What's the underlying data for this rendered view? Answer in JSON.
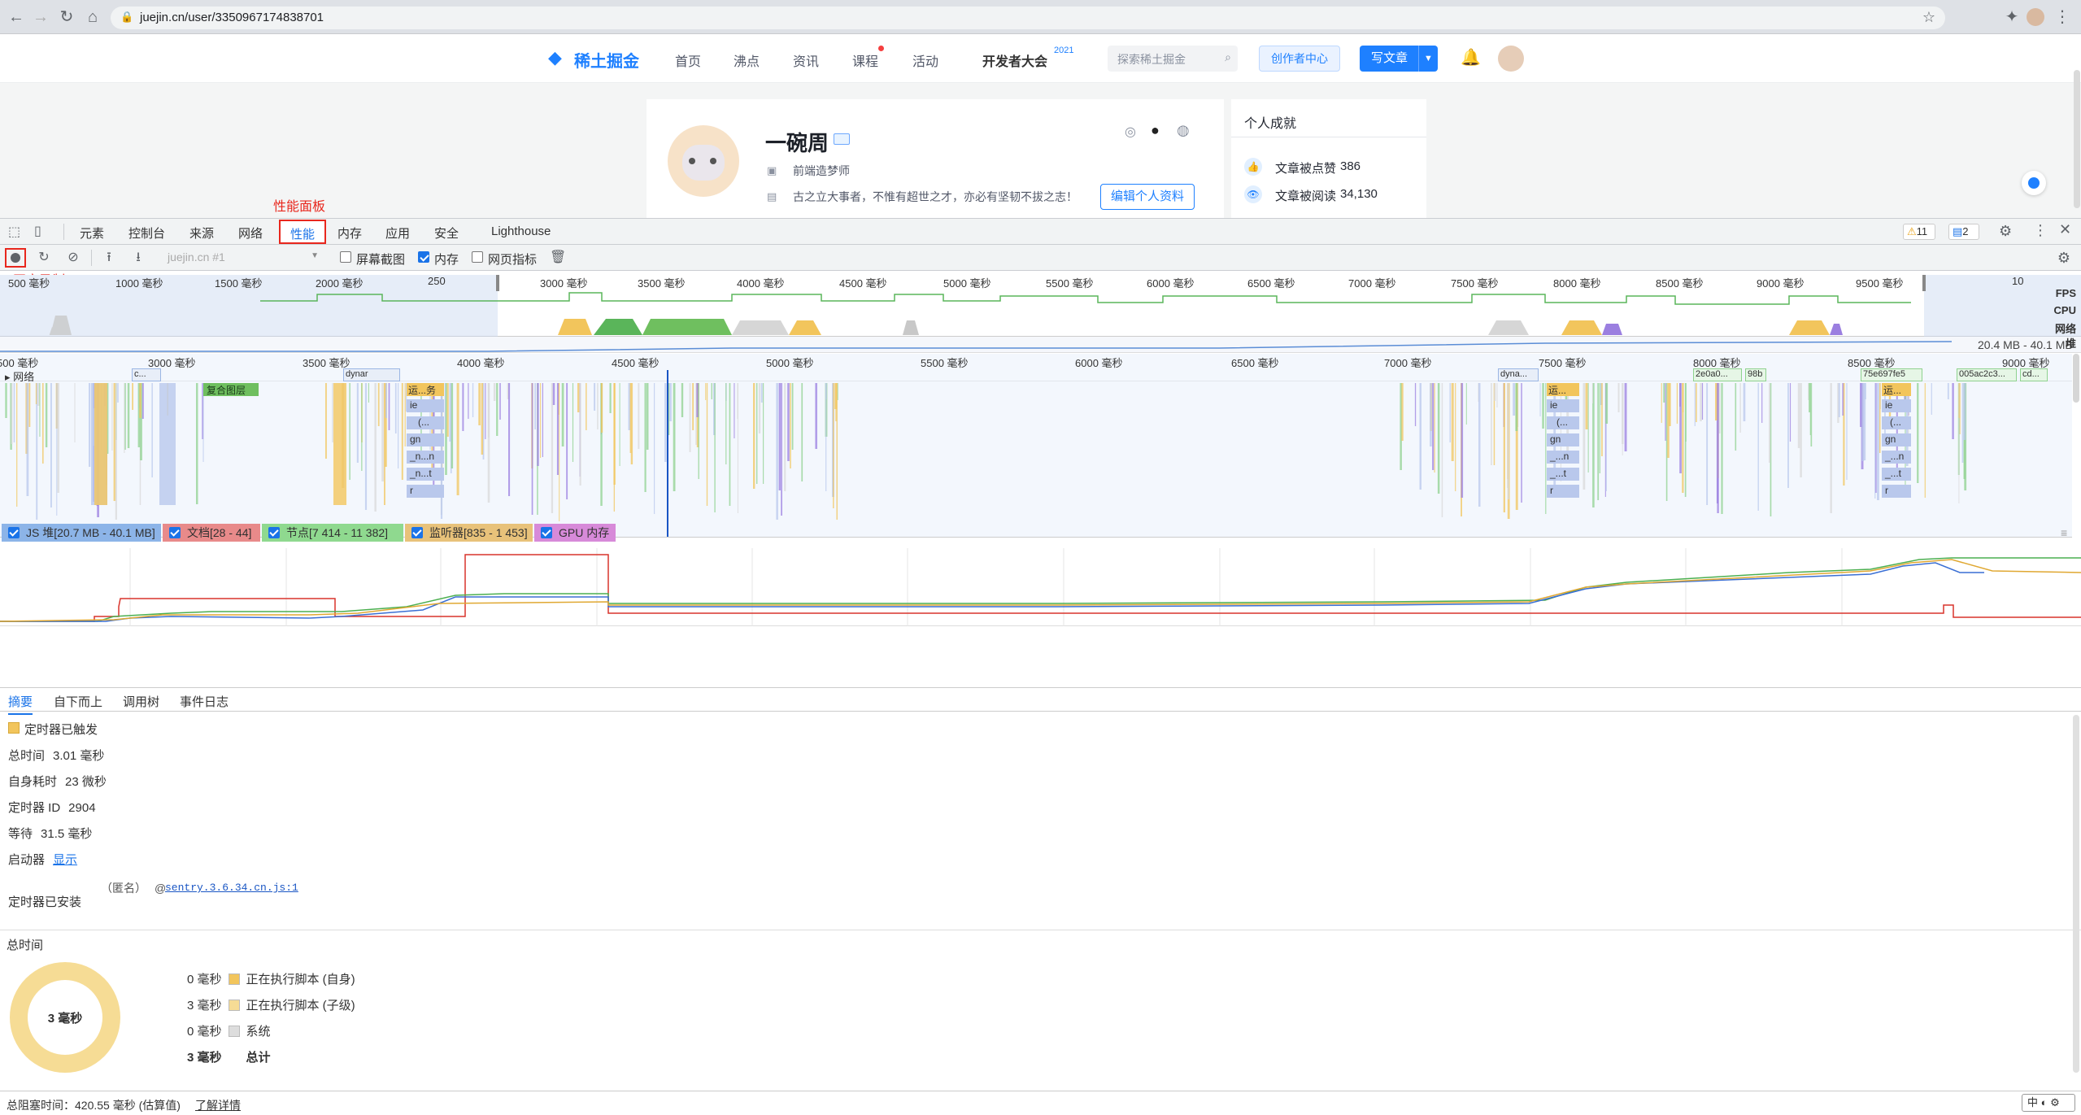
{
  "browser": {
    "url": "juejin.cn/user/3350967174838701"
  },
  "site": {
    "logo": "稀土掘金",
    "nav": [
      "首页",
      "沸点",
      "资讯",
      "课程",
      "活动",
      "开发者大会"
    ],
    "nav_sup": "2021",
    "search_placeholder": "探索稀土掘金",
    "creator_btn": "创作者中心",
    "write_btn": "写文章",
    "profile": {
      "name": "一碗周",
      "job": "前端造梦师",
      "bio": "古之立大事者，不惟有超世之才，亦必有坚韧不拔之志！",
      "edit_btn": "编辑个人资料"
    },
    "achievements": {
      "title": "个人成就",
      "items": [
        {
          "label": "文章被点赞",
          "value": "386"
        },
        {
          "label": "文章被阅读",
          "value": "34,130"
        }
      ]
    }
  },
  "devtools": {
    "tabs": [
      "元素",
      "控制台",
      "来源",
      "网络",
      "性能",
      "内存",
      "应用",
      "安全",
      "Lighthouse"
    ],
    "active_tab": "性能",
    "warnings": "11",
    "messages": "2",
    "annotation_panel": "性能面板",
    "annotation_record": "开启录制",
    "profile_select": "juejin.cn #1",
    "checkboxes": [
      {
        "label": "屏幕截图",
        "checked": false
      },
      {
        "label": "内存",
        "checked": true
      },
      {
        "label": "网页指标",
        "checked": false
      }
    ],
    "overview_ticks": [
      "500 毫秒",
      "1000 毫秒",
      "1500 毫秒",
      "2000 毫秒",
      "250",
      "3000 毫秒",
      "3500 毫秒",
      "4000 毫秒",
      "4500 毫秒",
      "5000 毫秒",
      "5500 毫秒",
      "6000 毫秒",
      "6500 毫秒",
      "7000 毫秒",
      "7500 毫秒",
      "8000 毫秒",
      "8500 毫秒",
      "9000 毫秒",
      "9500 毫秒",
      "10"
    ],
    "overview_labels": [
      "FPS",
      "CPU",
      "网络",
      "堆"
    ],
    "heap_range": "20.4 MB - 40.1 MB",
    "flame_ticks": [
      "500 毫秒",
      "3000 毫秒",
      "3500 毫秒",
      "4000 毫秒",
      "4500 毫秒",
      "5000 毫秒",
      "5500 毫秒",
      "6000 毫秒",
      "6500 毫秒",
      "7000 毫秒",
      "7500 毫秒",
      "8000 毫秒",
      "8500 毫秒",
      "9000 毫秒"
    ],
    "network_label": "网络",
    "network_items": [
      "c...",
      "dynar",
      "dyna...",
      "2e0a0...",
      "98b",
      "75e697fe5",
      "005ac2c3...",
      "cd..."
    ],
    "flame_labels": [
      "复合图层",
      "运...务",
      "ie",
      "(...",
      "gn",
      "_n...n",
      "_n...t",
      "r",
      "运...",
      "_...n",
      "_...t",
      "运..."
    ],
    "legend": [
      {
        "label": "JS 堆[20.7 MB - 40.1 MB]",
        "color": "#8cb4e8"
      },
      {
        "label": "文档[28 - 44]",
        "color": "#e88a8a"
      },
      {
        "label": "节点[7 414 - 11 382]",
        "color": "#8fd98f"
      },
      {
        "label": "监听器[835 - 1 453]",
        "color": "#e8c27a"
      },
      {
        "label": "GPU 内存",
        "color": "#d78ad9"
      }
    ],
    "summary_tabs": [
      "摘要",
      "自下而上",
      "调用树",
      "事件日志"
    ],
    "event_title": "定时器已触发",
    "event_color": "#f2c55c",
    "details": [
      {
        "label": "总时间",
        "value": "3.01 毫秒"
      },
      {
        "label": "自身耗时",
        "value": "23 微秒"
      },
      {
        "label": "定时器 ID",
        "value": "2904"
      },
      {
        "label": "等待",
        "value": "31.5 毫秒"
      },
      {
        "label": "启动器",
        "value": "显示"
      }
    ],
    "installed_label": "定时器已安装",
    "installed_anon": "（匿名）",
    "installed_at": "@",
    "installed_link": "sentry.3.6.34.cn.js:1",
    "total_time_label": "总时间",
    "donut_label": "3 毫秒",
    "breakdown": [
      {
        "value": "0 毫秒",
        "label": "正在执行脚本 (自身)",
        "color": "#f2c55c"
      },
      {
        "value": "3 毫秒",
        "label": "正在执行脚本 (子级)",
        "color": "#f6dc95"
      },
      {
        "value": "0 毫秒",
        "label": "系统",
        "color": "#dddddd"
      }
    ],
    "total_value": "3 毫秒",
    "total_label": "总计",
    "status": "总阻塞时间：420.55 毫秒 (估算值)",
    "status_link": "了解详情",
    "ime": "中"
  }
}
